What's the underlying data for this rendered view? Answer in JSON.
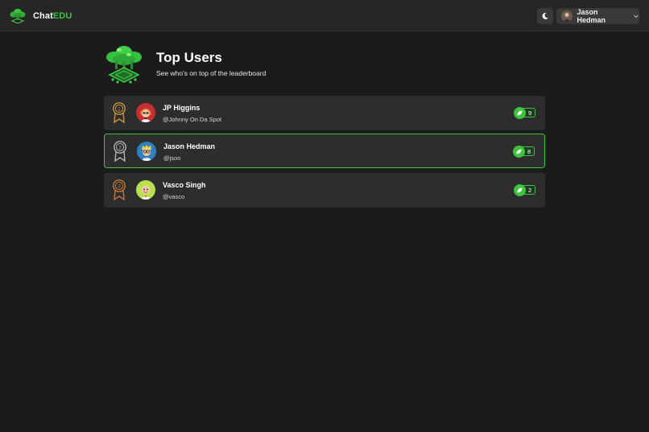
{
  "app": {
    "brand_prefix": "Chat",
    "brand_suffix": "EDU"
  },
  "topbar": {
    "theme_icon": "moon-icon",
    "user_name": "Jason Hedman",
    "dropdown_icon": "chevron-down-icon"
  },
  "page": {
    "title": "Top Users",
    "subtitle": "See who's on top of the leaderboard"
  },
  "leaderboard": [
    {
      "rank": "1",
      "name": "JP Higgins",
      "handle": "@Johnny On Da Spot",
      "score": "9",
      "medal_color": "#c9963a",
      "avatar_bg": "#c62f2f",
      "highlight": false
    },
    {
      "rank": "2",
      "name": "Jason Hedman",
      "handle": "@json",
      "score": "8",
      "medal_color": "#b4b4b4",
      "avatar_bg": "#2e7fc2",
      "highlight": true
    },
    {
      "rank": "3",
      "name": "Vasco Singh",
      "handle": "@vasco",
      "score": "2",
      "medal_color": "#c07a3a",
      "avatar_bg": "#b8e04a",
      "highlight": false
    }
  ],
  "colors": {
    "accent": "#3fc23f",
    "background": "#1b1b1b",
    "card": "#2d2d2d",
    "topbar": "#262626"
  }
}
